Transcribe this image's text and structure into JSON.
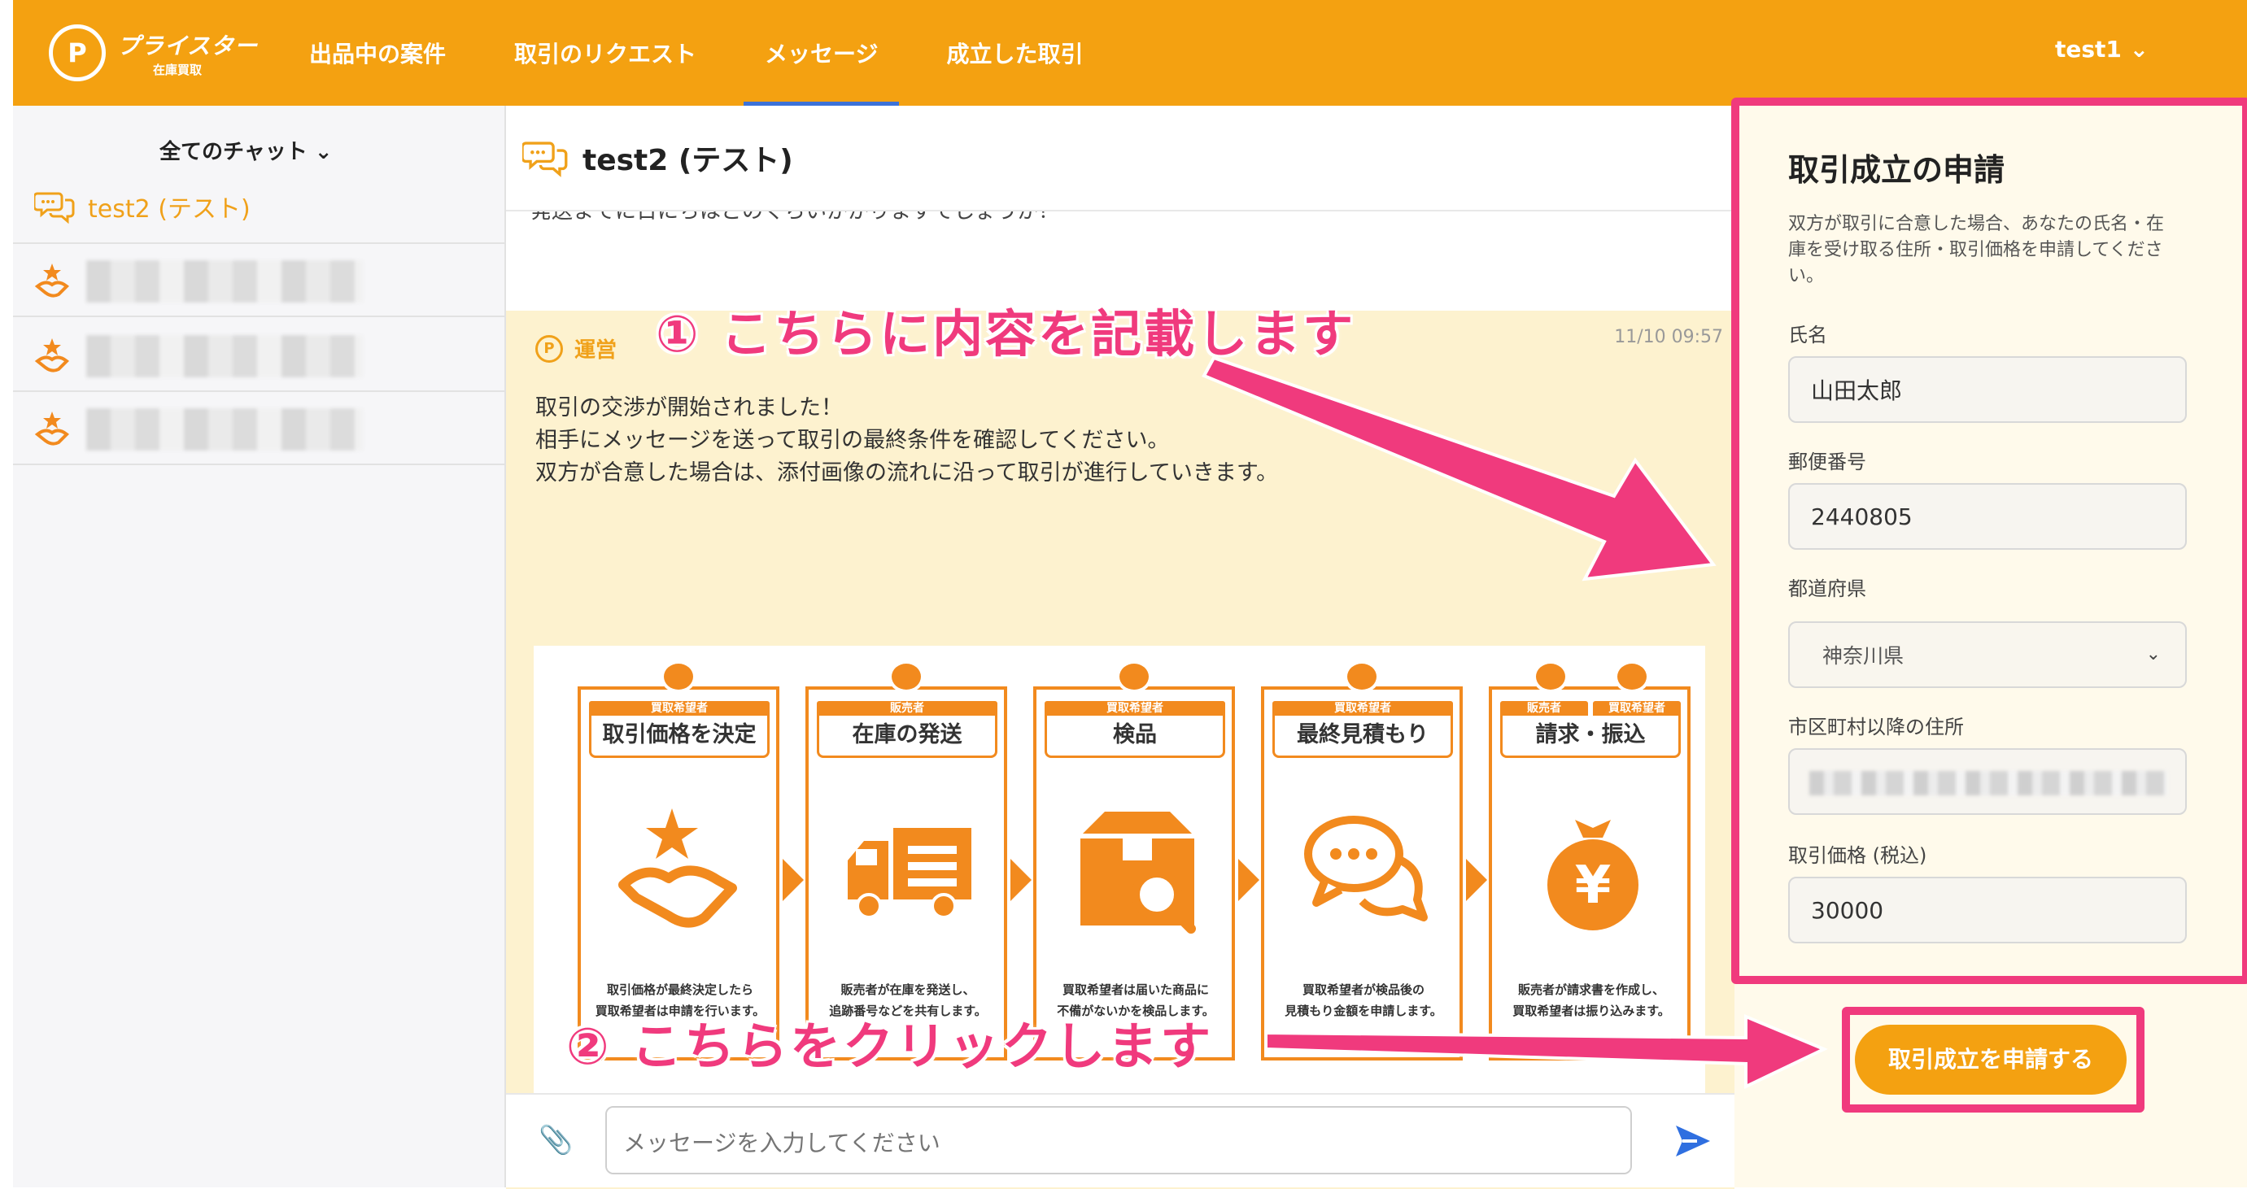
{
  "header": {
    "logo_main": "プライスター",
    "logo_sub": "在庫買取",
    "logo_mark": "P",
    "nav": [
      {
        "label": "出品中の案件"
      },
      {
        "label": "取引のリクエスト"
      },
      {
        "label": "メッセージ"
      },
      {
        "label": "成立した取引"
      }
    ],
    "active_nav": "メッセージ",
    "user": "test1 ⌄"
  },
  "sidebar": {
    "filter_label": "全てのチャット ⌄",
    "chats": [
      {
        "name": "test2 (テスト)"
      }
    ]
  },
  "chat": {
    "title": "test2 (テスト)",
    "previous_line": "発送までに日にちはどのくらいかかりますでしょうか？",
    "message": {
      "sender": "運営",
      "sender_mark": "P",
      "timestamp": "11/10 09:57",
      "lines": [
        "取引の交渉が開始されました！",
        "相手にメッセージを送って取引の最終条件を確認してください。",
        "双方が合意した場合は、添付画像の流れに沿って取引が進行していきます。"
      ]
    },
    "flow_steps": [
      {
        "role": "買取希望者",
        "title": "取引価格を決定",
        "desc1": "取引価格が最終決定したら",
        "desc2": "買取希望者は申請を行います。",
        "icon": "handshake-star-icon"
      },
      {
        "role": "販売者",
        "title": "在庫の発送",
        "desc1": "販売者が在庫を発送し、",
        "desc2": "追跡番号などを共有します。",
        "icon": "truck-icon"
      },
      {
        "role": "買取希望者",
        "title": "検品",
        "desc1": "買取希望者は届いた商品に",
        "desc2": "不備がないかを検品します。",
        "icon": "box-search-icon"
      },
      {
        "role": "買取希望者",
        "title": "最終見積もり",
        "desc1": "買取希望者が検品後の",
        "desc2": "見積もり金額を申請します。",
        "icon": "speech-bubbles-icon"
      },
      {
        "role": "販売者",
        "role2": "買取希望者",
        "title": "請求・振込",
        "desc1": "販売者が請求書を作成し、",
        "desc2": "買取希望者は振り込みます。",
        "icon": "money-bag-yen-icon",
        "yen": "¥"
      }
    ],
    "input_placeholder": "メッセージを入力してください"
  },
  "form": {
    "title": "取引成立の申請",
    "description": "双方が取引に合意した場合、あなたの氏名・在庫を受け取る住所・取引価格を申請してください。",
    "name_label": "氏名",
    "name_value": "山田太郎",
    "zip_label": "郵便番号",
    "zip_value": "2440805",
    "pref_label": "都道府県",
    "pref_value": "神奈川県",
    "address_label": "市区町村以降の住所",
    "price_label": "取引価格 (税込)",
    "price_value": "30000",
    "submit_label": "取引成立を申請する"
  },
  "annotations": {
    "step1": "① こちらに内容を記載します",
    "step2": "② こちらをクリックします",
    "color": "#f03a7d"
  },
  "colors": {
    "brand": "#f4a111",
    "flow_orange": "#f28a1e",
    "message_bg": "#fdf2cf",
    "active_underline": "#3c72d8"
  }
}
